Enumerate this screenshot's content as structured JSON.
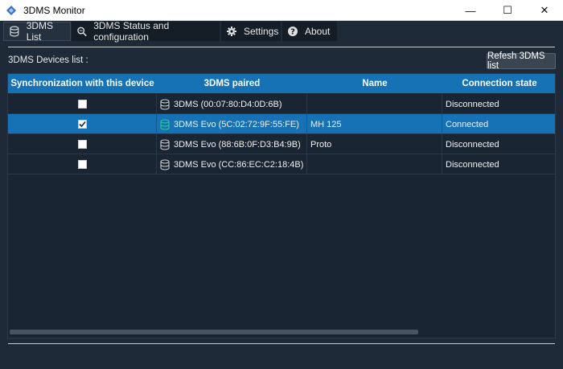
{
  "window": {
    "title": "3DMS Monitor",
    "controls": {
      "minimize": "—",
      "maximize": "☐",
      "close": "✕"
    }
  },
  "tabs": [
    {
      "label": "3DMS List",
      "icon": "database-icon",
      "active": true
    },
    {
      "label": "3DMS Status and configuration",
      "icon": "zoom-icon",
      "active": false
    },
    {
      "label": "Settings",
      "icon": "gear-icon",
      "active": false
    },
    {
      "label": "About",
      "icon": "help-icon",
      "active": false
    }
  ],
  "devices_label": "3DMS Devices list :",
  "refresh_label": "Refesh 3DMS list",
  "table": {
    "columns": [
      "Synchronization with this device",
      "3DMS paired",
      "Name",
      "Connection state"
    ],
    "rows": [
      {
        "sync": false,
        "device": "3DMS (00:07:80:D4:0D:6B)",
        "name": "",
        "state": "Disconnected",
        "selected": false
      },
      {
        "sync": true,
        "device": "3DMS Evo (5C:02:72:9F:55:FE)",
        "name": "MH 125",
        "state": "Connected",
        "selected": true
      },
      {
        "sync": false,
        "device": "3DMS Evo (88:6B:0F:D3:B4:9B)",
        "name": "Proto",
        "state": "Disconnected",
        "selected": false
      },
      {
        "sync": false,
        "device": "3DMS Evo (CC:86:EC:C2:18:4B)",
        "name": "",
        "state": "Disconnected",
        "selected": false
      }
    ]
  },
  "colors": {
    "accent": "#1671b5",
    "connected_icon": "#2ec4a0",
    "disconnected_icon": "#c8c8c8"
  }
}
